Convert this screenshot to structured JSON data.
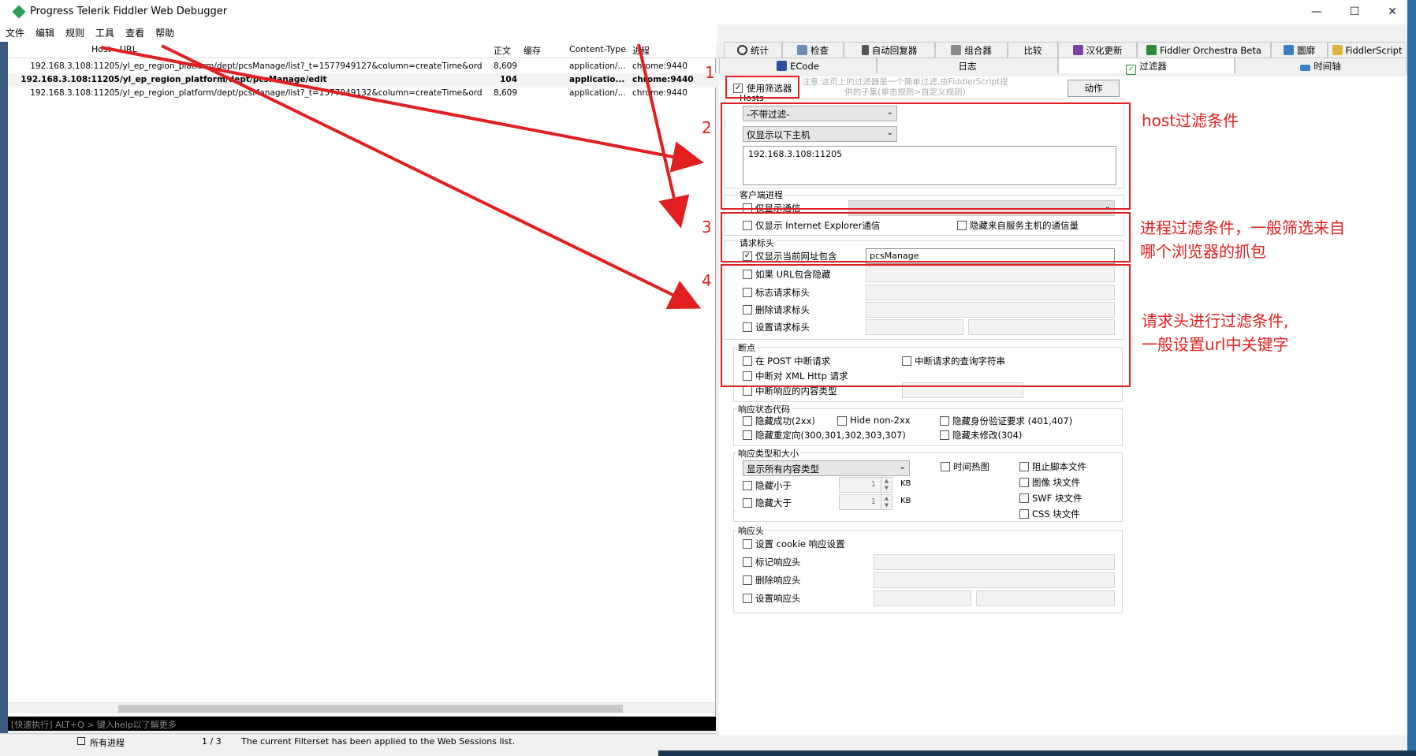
{
  "window": {
    "title": "Progress Telerik Fiddler Web Debugger"
  },
  "menu": [
    "文件",
    "编辑",
    "规则",
    "工具",
    "查看",
    "帮助"
  ],
  "sessions": {
    "columns": [
      "Host",
      "URL",
      "正文",
      "缓存",
      "Content-Type",
      "进程"
    ],
    "rows": [
      {
        "host": "192.168.3.108:11205",
        "url": "/yl_ep_region_platform/dept/pcsManage/list?_t=1577949127&column=createTime&order...",
        "body": "8,609",
        "caching": "",
        "ctype": "application/...",
        "process": "chrome:9440",
        "bold": false
      },
      {
        "host": "192.168.3.108:11205",
        "url": "/yl_ep_region_platform/dept/pcsManage/edit",
        "body": "104",
        "caching": "",
        "ctype": "applicatio...",
        "process": "chrome:9440",
        "bold": true
      },
      {
        "host": "192.168.3.108:11205",
        "url": "/yl_ep_region_platform/dept/pcsManage/list?_t=1577949132&column=createTime&order...",
        "body": "8,609",
        "caching": "",
        "ctype": "application/...",
        "process": "chrome:9440",
        "bold": false
      }
    ]
  },
  "quickexec": {
    "placeholder": "[快速执行] ALT+Q > 键入help以了解更多"
  },
  "status": {
    "process": "所有进程",
    "count": "1 / 3",
    "message": "The current Filterset has been applied to the Web Sessions list."
  },
  "tabs_row1": [
    "统计",
    "检查",
    "自动回复器",
    "组合器",
    "比较",
    "汉化更新",
    "Fiddler Orchestra Beta",
    "圖廓",
    "FiddlerScript"
  ],
  "tabs_row2": [
    "ECode",
    "日志",
    "过滤器",
    "时间轴"
  ],
  "filters": {
    "use_filters": "使用筛选器",
    "note": "注意:这页上的过滤器是一个简单过滤,由FiddlerScript提供的子集(单击规则>自定义规则)",
    "actions": "动作",
    "hosts": {
      "title": "Hosts",
      "zone": "-不带过滤-",
      "host_mode": "仅显示以下主机",
      "host_list": "192.168.3.108:11205"
    },
    "client": {
      "title": "客户端进程",
      "only_traffic": "仅显示通信",
      "only_ie": "仅显示 Internet Explorer通信",
      "hide_service": "隐藏来自服务主机的通信量"
    },
    "request": {
      "title": "请求标头",
      "url_contains": "仅显示当前网址包含",
      "url_value": "pcsManage",
      "hide_url": "如果 URL包含隐藏",
      "flag": "标志请求标头",
      "delete": "删除请求标头",
      "set": "设置请求标头"
    },
    "breakpoints": {
      "title": "断点",
      "post": "在 POST 中断请求",
      "querystring": "中断请求的查询字符串",
      "xhr": "中断对 XML Http 请求",
      "ctype": "中断响应的内容类型"
    },
    "status_code": {
      "title": "响应状态代码",
      "hide_2xx": "隐藏成功(2xx)",
      "non2xx": "Hide non-2xx",
      "auth": "隐藏身份验证要求 (401,407)",
      "redirect": "隐藏重定向(300,301,302,303,307)",
      "not_modified": "隐藏未修改(304)"
    },
    "type_size": {
      "title": "响应类型和大小",
      "show_types": "显示所有内容类型",
      "smaller": "隐藏小于",
      "larger": "隐藏大于",
      "kb": "KB",
      "val": "1",
      "heatmap": "时间热图",
      "block_script": "阻止脚本文件",
      "image": "图像 块文件",
      "swf": "SWF 块文件",
      "css": "CSS 块文件"
    },
    "response_headers": {
      "title": "响应头",
      "cookie": "设置 cookie 响应设置",
      "flag": "标记响应头",
      "delete": "删除响应头",
      "set": "设置响应头"
    }
  },
  "annotations": {
    "n1": "1",
    "n2": "2",
    "n3": "3",
    "n4": "4",
    "host": "host过滤条件",
    "process_l1": "进程过滤条件，一般筛选来自",
    "process_l2": "哪个浏览器的抓包",
    "request_l1": "请求头进行过滤条件,",
    "request_l2": "一般设置url中关键字"
  },
  "colors": {
    "accent": "#e02020",
    "quick_bg": "#000000"
  }
}
